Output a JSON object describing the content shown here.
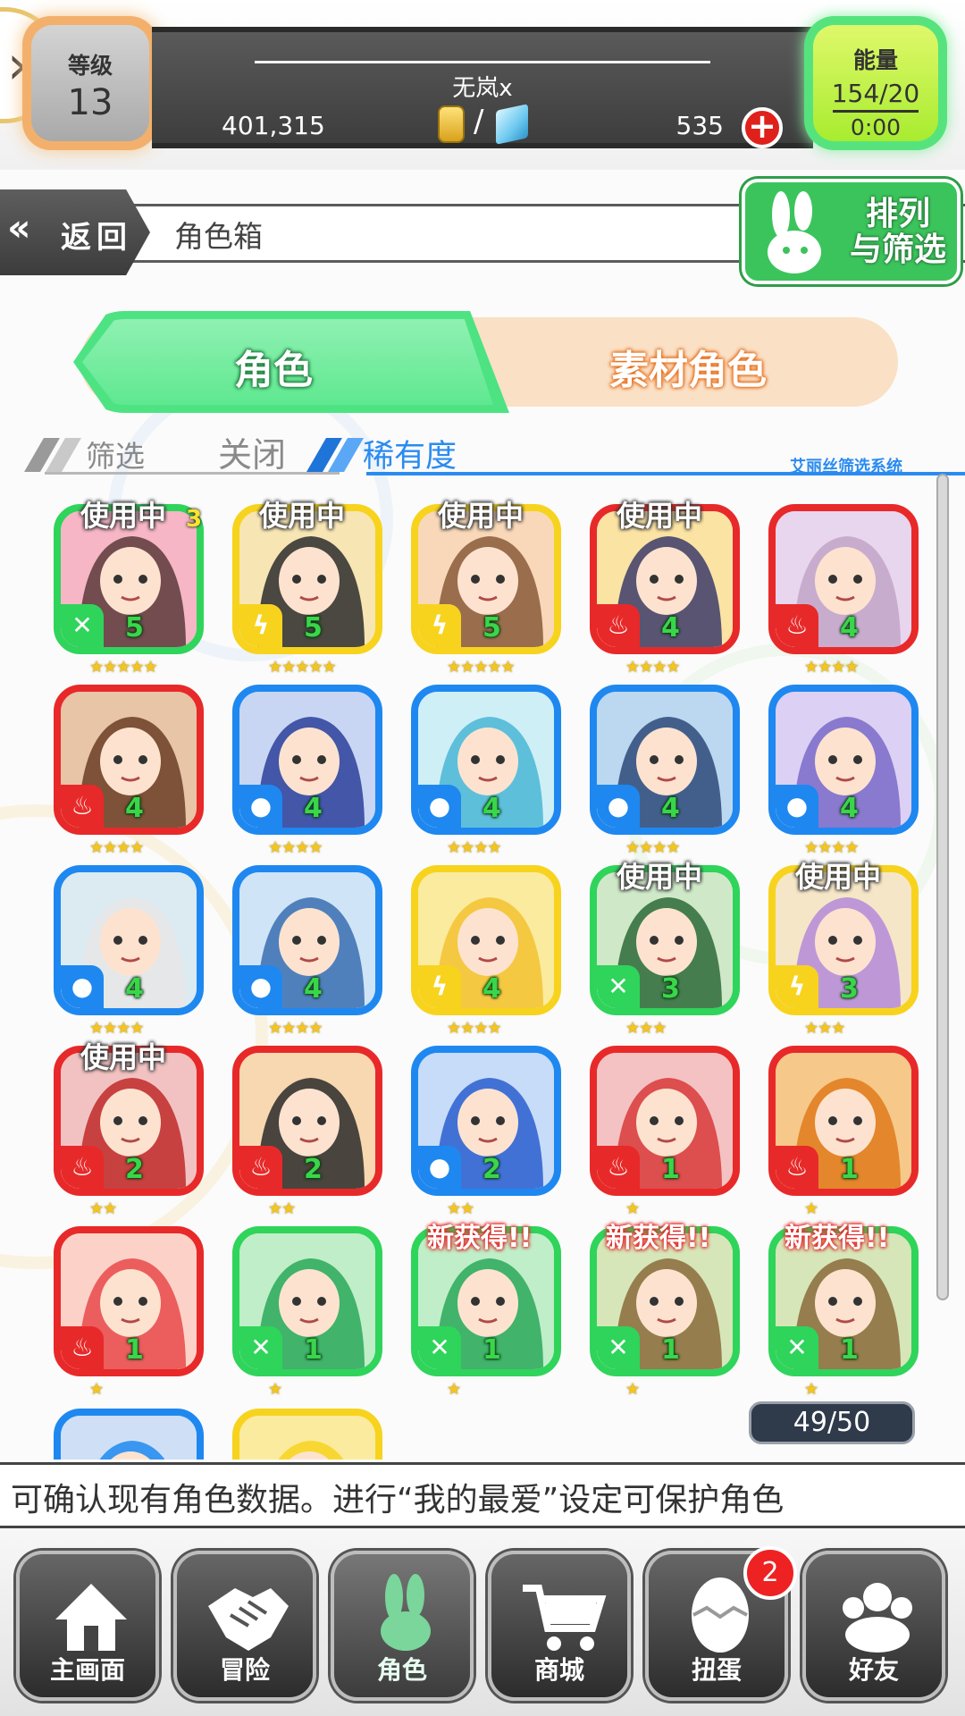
{
  "header": {
    "level_label": "等级",
    "level_value": "13",
    "player_name": "无岚x",
    "coins": "401,315",
    "gems": "535",
    "energy_label": "能量",
    "energy_value": "154/20",
    "energy_timer": "0:00"
  },
  "nav": {
    "back_label": "返回",
    "page_title": "角色箱",
    "sort_line1": "排列",
    "sort_line2": "与筛选"
  },
  "tabs": {
    "active": "角色",
    "inactive": "素材角色"
  },
  "filter": {
    "label": "筛选",
    "close": "关闭",
    "rarity": "稀有度",
    "system": "艾丽丝筛选系统"
  },
  "tags": {
    "in_use": "使用中",
    "new": "新获得!!"
  },
  "colors": {
    "wind": "#2fd45b",
    "thunder": "#f7d31e",
    "fire": "#e82929",
    "water": "#1e88f0"
  },
  "cards": [
    {
      "element": "wind",
      "level": "5",
      "stars": "★★★★★",
      "in_use": true,
      "dup": "3"
    },
    {
      "element": "thunder",
      "level": "5",
      "stars": "★★★★★",
      "in_use": true
    },
    {
      "element": "thunder",
      "level": "5",
      "stars": "★★★★★",
      "in_use": true
    },
    {
      "element": "fire",
      "level": "4",
      "stars": "★★★★",
      "in_use": true
    },
    {
      "element": "fire",
      "level": "4",
      "stars": "★★★★"
    },
    {
      "element": "fire",
      "level": "4",
      "stars": "★★★★"
    },
    {
      "element": "water",
      "level": "4",
      "stars": "★★★★"
    },
    {
      "element": "water",
      "level": "4",
      "stars": "★★★★"
    },
    {
      "element": "water",
      "level": "4",
      "stars": "★★★★"
    },
    {
      "element": "water",
      "level": "4",
      "stars": "★★★★"
    },
    {
      "element": "water",
      "level": "4",
      "stars": "★★★★"
    },
    {
      "element": "water",
      "level": "4",
      "stars": "★★★★"
    },
    {
      "element": "thunder",
      "level": "4",
      "stars": "★★★★"
    },
    {
      "element": "wind",
      "level": "3",
      "stars": "★★★",
      "in_use": true
    },
    {
      "element": "thunder",
      "level": "3",
      "stars": "★★★",
      "in_use": true
    },
    {
      "element": "fire",
      "level": "2",
      "stars": "★★",
      "in_use": true
    },
    {
      "element": "fire",
      "level": "2",
      "stars": "★★"
    },
    {
      "element": "water",
      "level": "2",
      "stars": "★★"
    },
    {
      "element": "fire",
      "level": "1",
      "stars": "★"
    },
    {
      "element": "fire",
      "level": "1",
      "stars": "★"
    },
    {
      "element": "fire",
      "level": "1",
      "stars": "★"
    },
    {
      "element": "wind",
      "level": "1",
      "stars": "★"
    },
    {
      "element": "wind",
      "level": "1",
      "stars": "★",
      "new": true
    },
    {
      "element": "wind",
      "level": "1",
      "stars": "★",
      "new": true
    },
    {
      "element": "wind",
      "level": "1",
      "stars": "★",
      "new": true
    },
    {
      "element": "water",
      "level": "",
      "stars": ""
    },
    {
      "element": "thunder",
      "level": "",
      "stars": ""
    }
  ],
  "count": "49/50",
  "ticker": "可确认现有角色数据。进行“我的最爱”设定可保护角色",
  "bottom_nav": [
    {
      "label": "主画面",
      "icon": "home-icon"
    },
    {
      "label": "冒险",
      "icon": "handshake-icon"
    },
    {
      "label": "角色",
      "icon": "bunny-icon"
    },
    {
      "label": "商城",
      "icon": "cart-icon"
    },
    {
      "label": "扭蛋",
      "icon": "egg-icon"
    },
    {
      "label": "好友",
      "icon": "friends-icon"
    }
  ],
  "gacha_badge": "2"
}
